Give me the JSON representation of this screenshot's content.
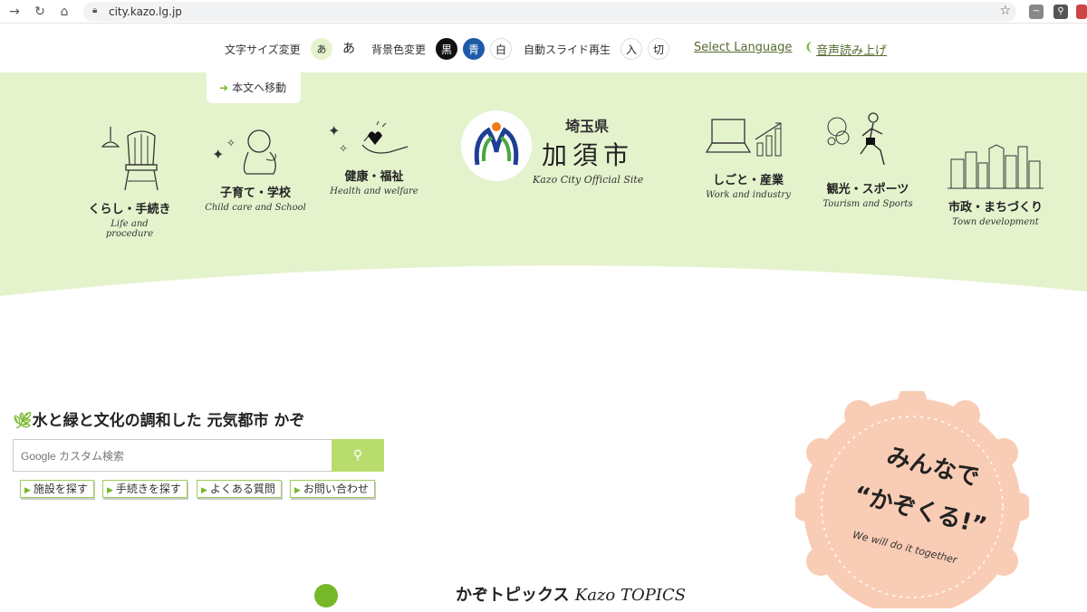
{
  "browser": {
    "url": "city.kazo.lg.jp"
  },
  "util": {
    "font_size_label": "文字サイズ変更",
    "font_small": "あ",
    "font_large": "あ",
    "bg_label": "背景色変更",
    "bg_black": "黒",
    "bg_blue": "青",
    "bg_white": "白",
    "slide_label": "自動スライド再生",
    "slide_on": "入",
    "slide_off": "切",
    "language": "Select Language",
    "voice": "音声読み上げ"
  },
  "skip_link": "本文へ移動",
  "header": {
    "pref": "埼玉県",
    "city": "加須市",
    "official": "Kazo City Official Site"
  },
  "categories": [
    {
      "jp": "くらし・手続き",
      "en": "Life and procedure"
    },
    {
      "jp": "子育て・学校",
      "en": "Child care and School"
    },
    {
      "jp": "健康・福祉",
      "en": "Health and welfare"
    },
    {
      "jp": "しごと・産業",
      "en": "Work and industry"
    },
    {
      "jp": "観光・スポーツ",
      "en": "Tourism and Sports"
    },
    {
      "jp": "市政・まちづくり",
      "en": "Town development"
    }
  ],
  "tagline": "水と緑と文化の調和した 元気都市 かぞ",
  "search": {
    "placeholder": "Google カスタム検索"
  },
  "quick_links": [
    "施設を探す",
    "手続きを探す",
    "よくある質問",
    "お問い合わせ"
  ],
  "badge": {
    "line1": "みんなで",
    "line2": "“かぞくる!”",
    "en": "We will do it together"
  },
  "topics": {
    "jp": "かぞトピックス",
    "en": "Kazo TOPICS"
  },
  "colors": {
    "accent_green": "#76b82a",
    "band_green": "#e5f3cd",
    "badge_peach": "#f9cdb5"
  }
}
